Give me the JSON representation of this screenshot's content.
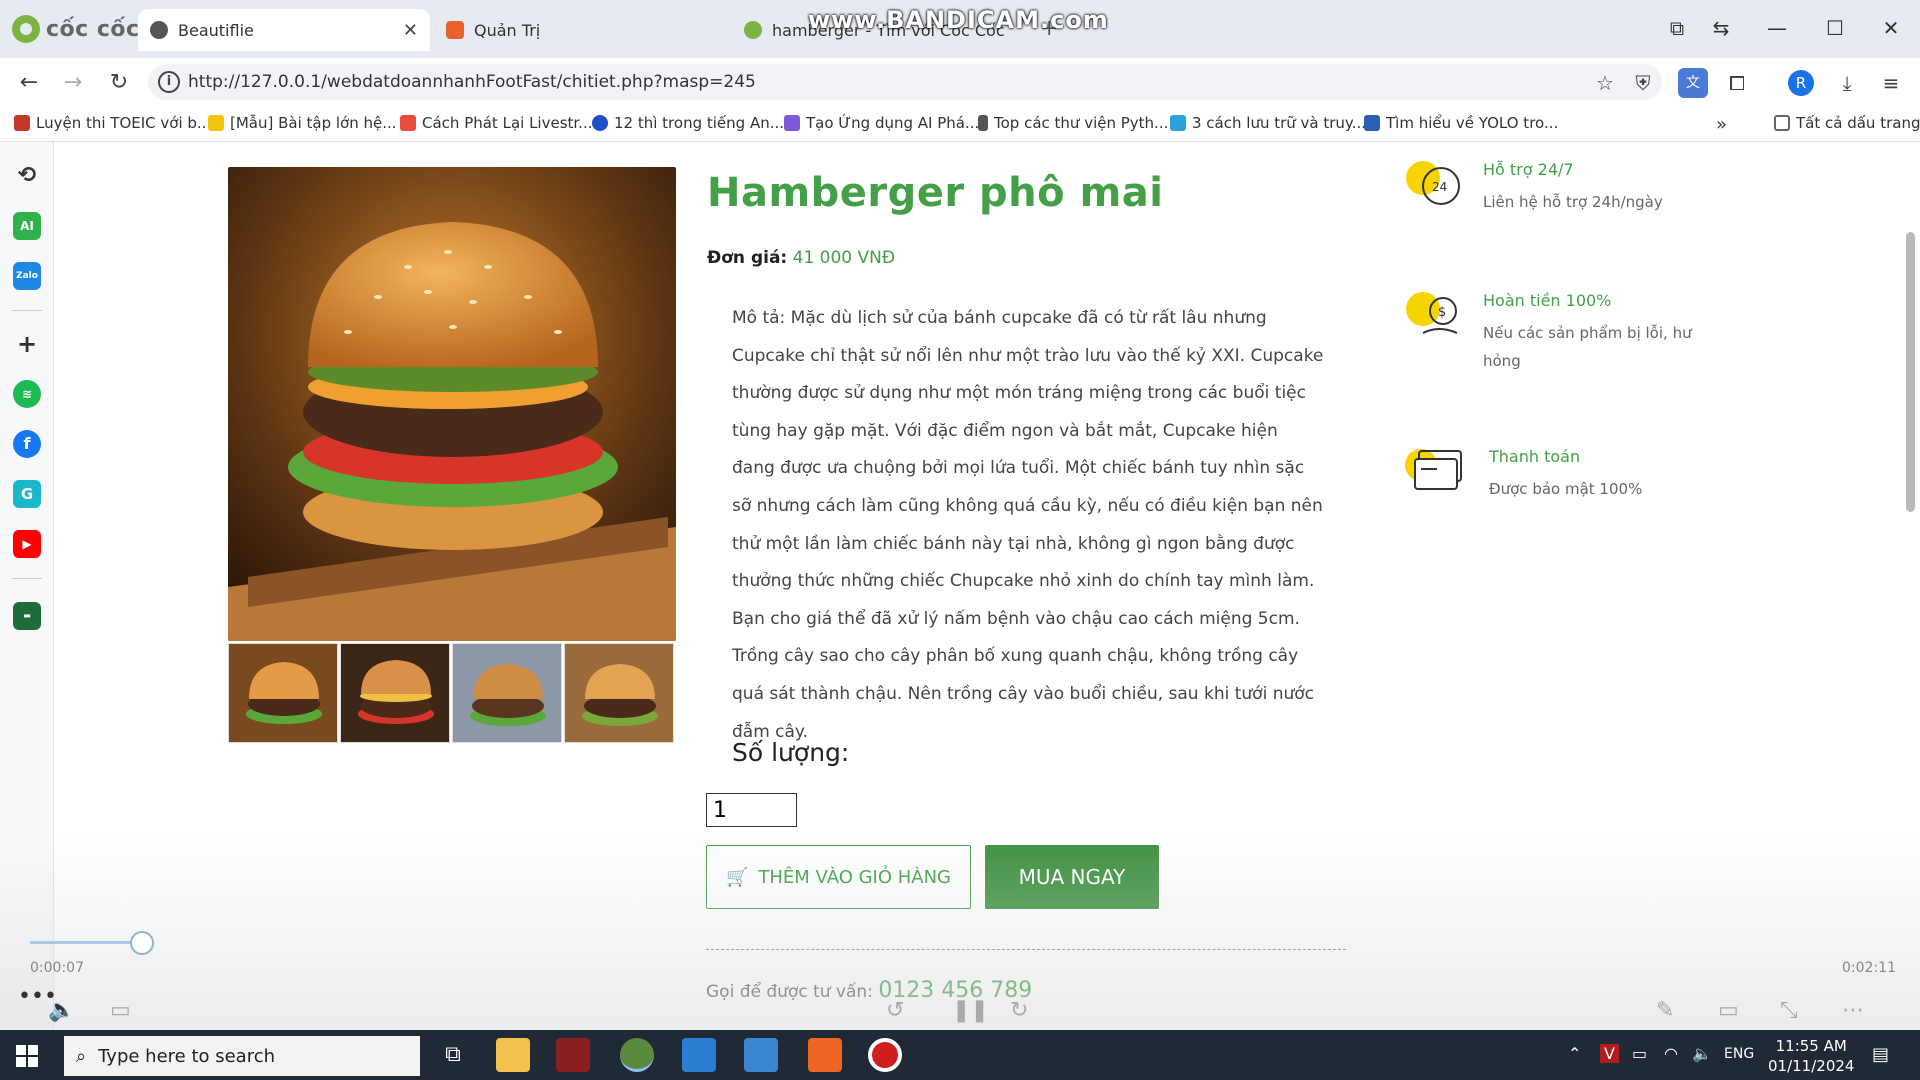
{
  "browser": {
    "brand": "cốc cốc",
    "watermark": "www.BANDICAM.com",
    "tabs": [
      {
        "label": "Beautiflie",
        "active": true
      },
      {
        "label": "Quản Trị",
        "active": false
      },
      {
        "label": "hamberger - Tìm với Cốc Cốc",
        "active": false
      }
    ],
    "url": "http://127.0.0.1/webdatdoannhanhFootFast/chitiet.php?masp=245",
    "avatar_letter": "R",
    "bookmarks": [
      {
        "label": "Luyện thi TOEIC với b...",
        "color": "#c0392b"
      },
      {
        "label": "[Mẫu] Bài tập lớn hệ...",
        "color": "#f1c40f"
      },
      {
        "label": "Cách Phát Lại Livestr...",
        "color": "#e74c3c"
      },
      {
        "label": "12 thì trong tiếng An...",
        "color": "#1e50c8"
      },
      {
        "label": "Tạo Ứng dụng AI Phá...",
        "color": "#7b5cd6"
      },
      {
        "label": "Top các thư viện Pyth...",
        "color": "#555555"
      },
      {
        "label": "3 cách lưu trữ và truy...",
        "color": "#29a3d9"
      },
      {
        "label": "Tìm hiểu về YOLO tro...",
        "color": "#2b5fb4"
      }
    ],
    "bookmarks_all": "Tất cả dấu trang"
  },
  "product": {
    "title": "Hamberger phô mai",
    "price_label": "Đơn giá:",
    "price_value": "41 000 VNĐ",
    "description": "Mô tả: Mặc dù lịch sử của bánh cupcake đã có từ rất lâu nhưng Cupcake chỉ thật sử nổi lên như một trào lưu vào thế kỷ XXI. Cupcake thường được sử dụng như một món tráng miệng trong các buổi tiệc tùng hay gặp mặt. Với đặc điểm ngon và bắt mắt, Cupcake hiện đang được ưa chuộng bởi mọi lứa tuổi. Một chiếc bánh tuy nhìn sặc sỡ nhưng cách làm cũng không quá cầu kỳ, nếu có điều kiện bạn nên thử một lần làm chiếc bánh này tại nhà, không gì ngon bằng được thưởng thức những chiếc Chupcake nhỏ xinh do chính tay mình làm. Bạn cho giá thể đã xử lý nấm bệnh vào chậu cao cách miệng 5cm. Trồng cây sao cho cây phân bố xung quanh chậu, không trồng cây quá sát thành chậu. Nên trồng cây vào buổi chiều, sau khi tưới nước đẫm cây.",
    "quantity_label": "Số lượng:",
    "quantity_value": "1",
    "add_to_cart": "THÊM VÀO GIỎ HÀNG",
    "buy_now": "MUA NGAY",
    "contact_label": "Gọi để được tư vấn:",
    "contact_phone": "0123 456 789"
  },
  "features": [
    {
      "title": "Hỗ trợ 24/7",
      "desc": "Liên hệ hỗ trợ 24h/ngày",
      "icon": "support-24-icon"
    },
    {
      "title": "Hoàn tiền 100%",
      "desc": "Nếu các sản phẩm bị lỗi, hư hỏng",
      "icon": "refund-icon"
    },
    {
      "title": "Thanh toán",
      "desc": "Được bảo mật 100%",
      "icon": "payment-card-icon"
    }
  ],
  "player": {
    "time_current": "0:00:07",
    "time_total": "0:02:11",
    "progress": 0.053
  },
  "taskbar": {
    "search_placeholder": "Type here to search",
    "language": "ENG",
    "time": "11:55 AM",
    "date": "01/11/2024"
  },
  "colors": {
    "accent_green": "#43a047",
    "buy_button": "#3d9140",
    "taskbar": "#1f2a36"
  }
}
